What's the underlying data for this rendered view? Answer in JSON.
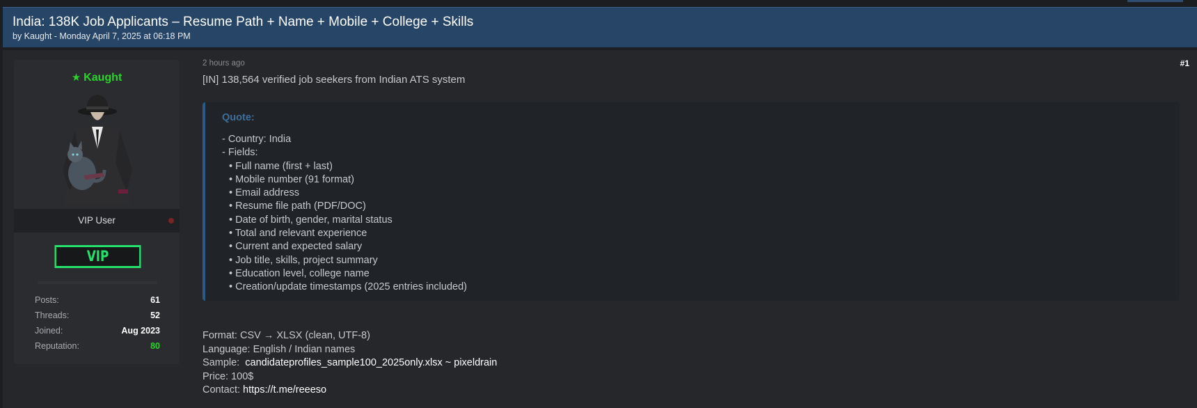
{
  "thread": {
    "title": "India: 138K Job Applicants – Resume Path + Name + Mobile + College + Skills",
    "meta": "by Kaught - Monday April 7, 2025 at 06:18 PM"
  },
  "user": {
    "name": "Kaught",
    "rank": "VIP User",
    "badge": "VIP",
    "stats": [
      {
        "label": "Posts:",
        "value": "61"
      },
      {
        "label": "Threads:",
        "value": "52"
      },
      {
        "label": "Joined:",
        "value": "Aug 2023"
      },
      {
        "label": "Reputation:",
        "value": "80"
      }
    ]
  },
  "post": {
    "time": "2 hours ago",
    "number": "#1",
    "headline": "[IN] 138,564 verified job seekers from Indian ATS system",
    "quote_label": "Quote:",
    "quote_lines": [
      "- Country: India",
      "- Fields:",
      "• Full name (first + last)",
      "• Mobile number (91 format)",
      "• Email address",
      "• Resume file path (PDF/DOC)",
      "• Date of birth, gender, marital status",
      "• Total and relevant experience",
      "• Current and expected salary",
      "• Job title, skills, project summary",
      "• Education level, college name",
      "• Creation/update timestamps (2025 entries included)"
    ],
    "format_label": "Format: CSV → XLSX (clean, UTF-8)",
    "language_label": "Language: English / Indian names",
    "sample_label": "Sample:",
    "sample_value": "candidateprofiles_sample100_2025only.xlsx ~ pixeldrain",
    "price_label": "Price: 100$",
    "contact_label": "Contact:",
    "contact_value": "https://t.me/reeeso"
  },
  "colors": {
    "header_bg": "#274566",
    "username": "#2ad42a",
    "vip_badge": "#25e06b",
    "quote_accent": "#2b5a86"
  }
}
